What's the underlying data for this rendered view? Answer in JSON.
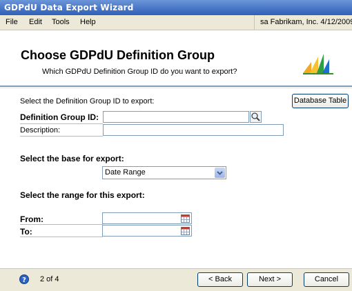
{
  "window": {
    "title": "GDPdU Data Export Wizard"
  },
  "menu": {
    "file": "File",
    "edit": "Edit",
    "tools": "Tools",
    "help": "Help"
  },
  "session": {
    "info": "sa  Fabrikam, Inc.  4/12/2009"
  },
  "header": {
    "title": "Choose GDPdU Definition Group",
    "subtitle": "Which GDPdU Definition Group ID do you want to export?"
  },
  "form": {
    "select_prompt": "Select the Definition Group ID to export:",
    "database_table_button": "Database Table",
    "definition_group_label": "Definition Group ID:",
    "definition_group_value": "",
    "description_label": "Description:",
    "description_value": "",
    "base_heading": "Select the base for export:",
    "base_selected": "Date Range",
    "range_heading": "Select the range for this export:",
    "from_label": "From:",
    "from_value": "",
    "to_label": "To:",
    "to_value": ""
  },
  "footer": {
    "page_indicator": "2 of 4",
    "back_button": "< Back",
    "next_button": "Next >",
    "cancel_button": "Cancel"
  },
  "icons": {
    "help": "help-icon",
    "lookup": "magnifier-icon",
    "calendar": "calendar-icon",
    "dropdown": "chevron-down-icon",
    "logo": "dynamics-logo-icon"
  },
  "colors": {
    "titlebar": "#2f5fb7",
    "chrome": "#ece9d8",
    "accent": "#7f9db9"
  }
}
